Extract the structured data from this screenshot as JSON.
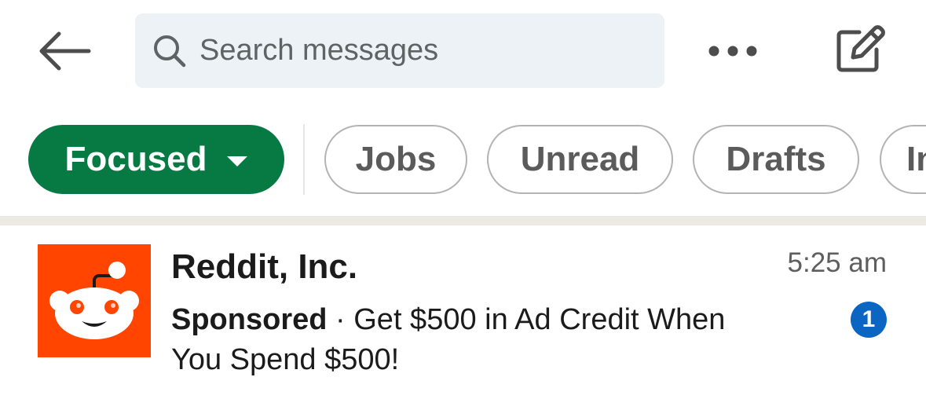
{
  "header": {
    "back_icon": "arrow-left-icon",
    "search": {
      "placeholder": "Search messages",
      "value": "",
      "icon": "search-icon"
    },
    "more_icon": "more-horizontal-icon",
    "compose_icon": "compose-icon"
  },
  "filters": {
    "chips": [
      {
        "label": "Focused",
        "active": true,
        "has_dropdown": true
      },
      {
        "label": "Jobs",
        "active": false
      },
      {
        "label": "Unread",
        "active": false
      },
      {
        "label": "Drafts",
        "active": false
      },
      {
        "label": "In",
        "active": false
      }
    ],
    "active_color": "#077a43"
  },
  "conversations": [
    {
      "sender": "Reddit, Inc.",
      "time": "5:25 am",
      "tag": "Sponsored",
      "separator": " · ",
      "message": "Get $500 in Ad Credit When You Spend $500!",
      "unread_count": "1",
      "avatar_icon": "reddit-logo-icon",
      "avatar_color": "#ff4500"
    }
  ],
  "colors": {
    "badge": "#0a66c2",
    "search_bg": "#edf2f6"
  }
}
